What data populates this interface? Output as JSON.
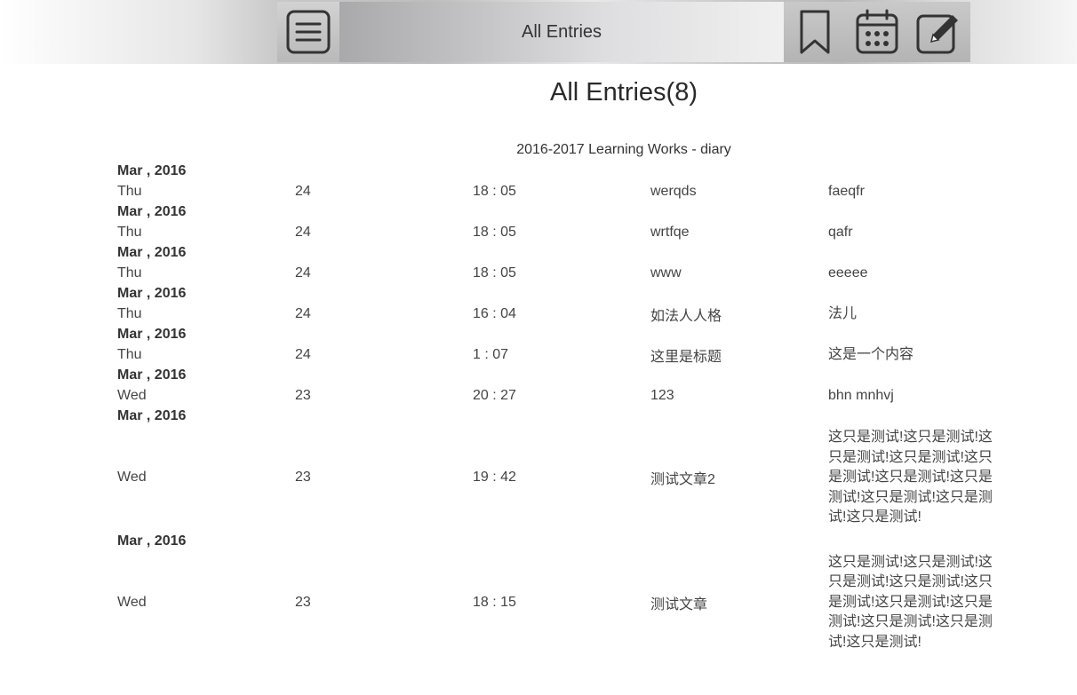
{
  "topbar": {
    "title": "All Entries"
  },
  "page": {
    "title": "All Entries(8)",
    "subtitle": "2016-2017 Learning Works - diary"
  },
  "entries": [
    {
      "month": "Mar , 2016",
      "weekday": "Thu",
      "day": "24",
      "time": "18 : 05",
      "title": "werqds",
      "content": "faeqfr"
    },
    {
      "month": "Mar , 2016",
      "weekday": "Thu",
      "day": "24",
      "time": "18 : 05",
      "title": "wrtfqe",
      "content": "qafr"
    },
    {
      "month": "Mar , 2016",
      "weekday": "Thu",
      "day": "24",
      "time": "18 : 05",
      "title": "www",
      "content": "eeeee"
    },
    {
      "month": "Mar , 2016",
      "weekday": "Thu",
      "day": "24",
      "time": "16 : 04",
      "title": "如法人人格",
      "content": "法儿"
    },
    {
      "month": "Mar , 2016",
      "weekday": "Thu",
      "day": "24",
      "time": "1 : 07",
      "title": "这里是标题",
      "content": "这是一个内容"
    },
    {
      "month": "Mar , 2016",
      "weekday": "Wed",
      "day": "23",
      "time": "20 : 27",
      "title": "123",
      "content": "bhn mnhvj"
    },
    {
      "month": "Mar , 2016",
      "weekday": "Wed",
      "day": "23",
      "time": "19 : 42",
      "title": "测试文章2",
      "content": "这只是测试!这只是测试!这只是测试!这只是测试!这只是测试!这只是测试!这只是测试!这只是测试!这只是测试!这只是测试!"
    },
    {
      "month": "Mar , 2016",
      "weekday": "Wed",
      "day": "23",
      "time": "18 : 15",
      "title": "测试文章",
      "content": "这只是测试!这只是测试!这只是测试!这只是测试!这只是测试!这只是测试!这只是测试!这只是测试!这只是测试!这只是测试!"
    }
  ]
}
